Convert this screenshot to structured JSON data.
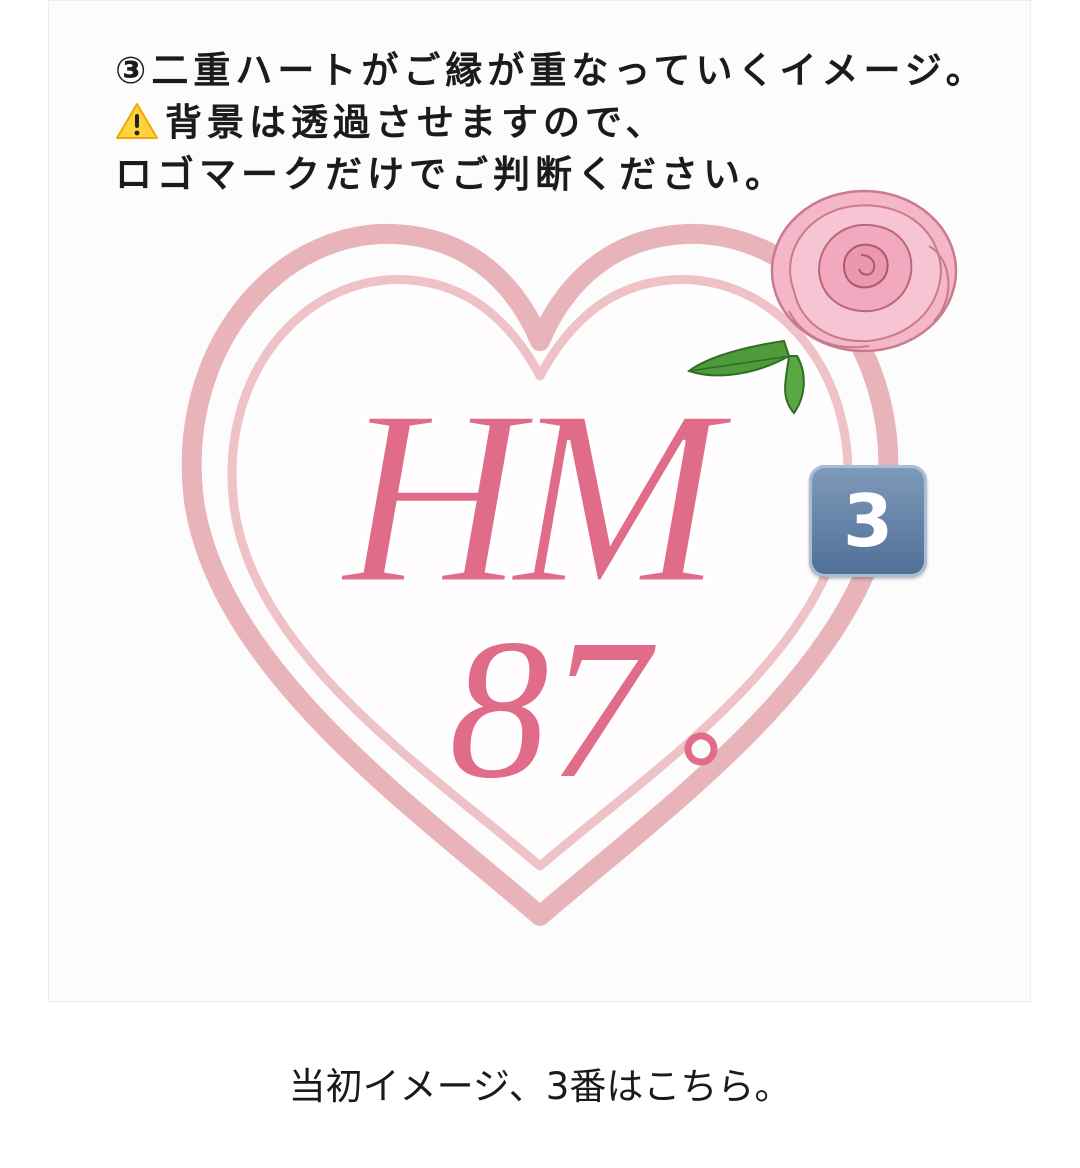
{
  "post_image": {
    "note_lines": [
      "③二重ハートがご縁が重なっていくイメージ。",
      "背景は透過させますので、",
      "ロゴマークだけでご判断ください。"
    ],
    "warning_icon": "warning-icon",
    "logo_monogram": "HM",
    "logo_number": "87",
    "number_badge": "3",
    "colors": {
      "heart_outline": "#e9b3ba",
      "lettering": "#e16c8a",
      "rose": "#f4b6c8",
      "leaf": "#4f9a3a",
      "badge": "#5f7fa3"
    }
  },
  "caption": "当初イメージ、3番はこちら。"
}
